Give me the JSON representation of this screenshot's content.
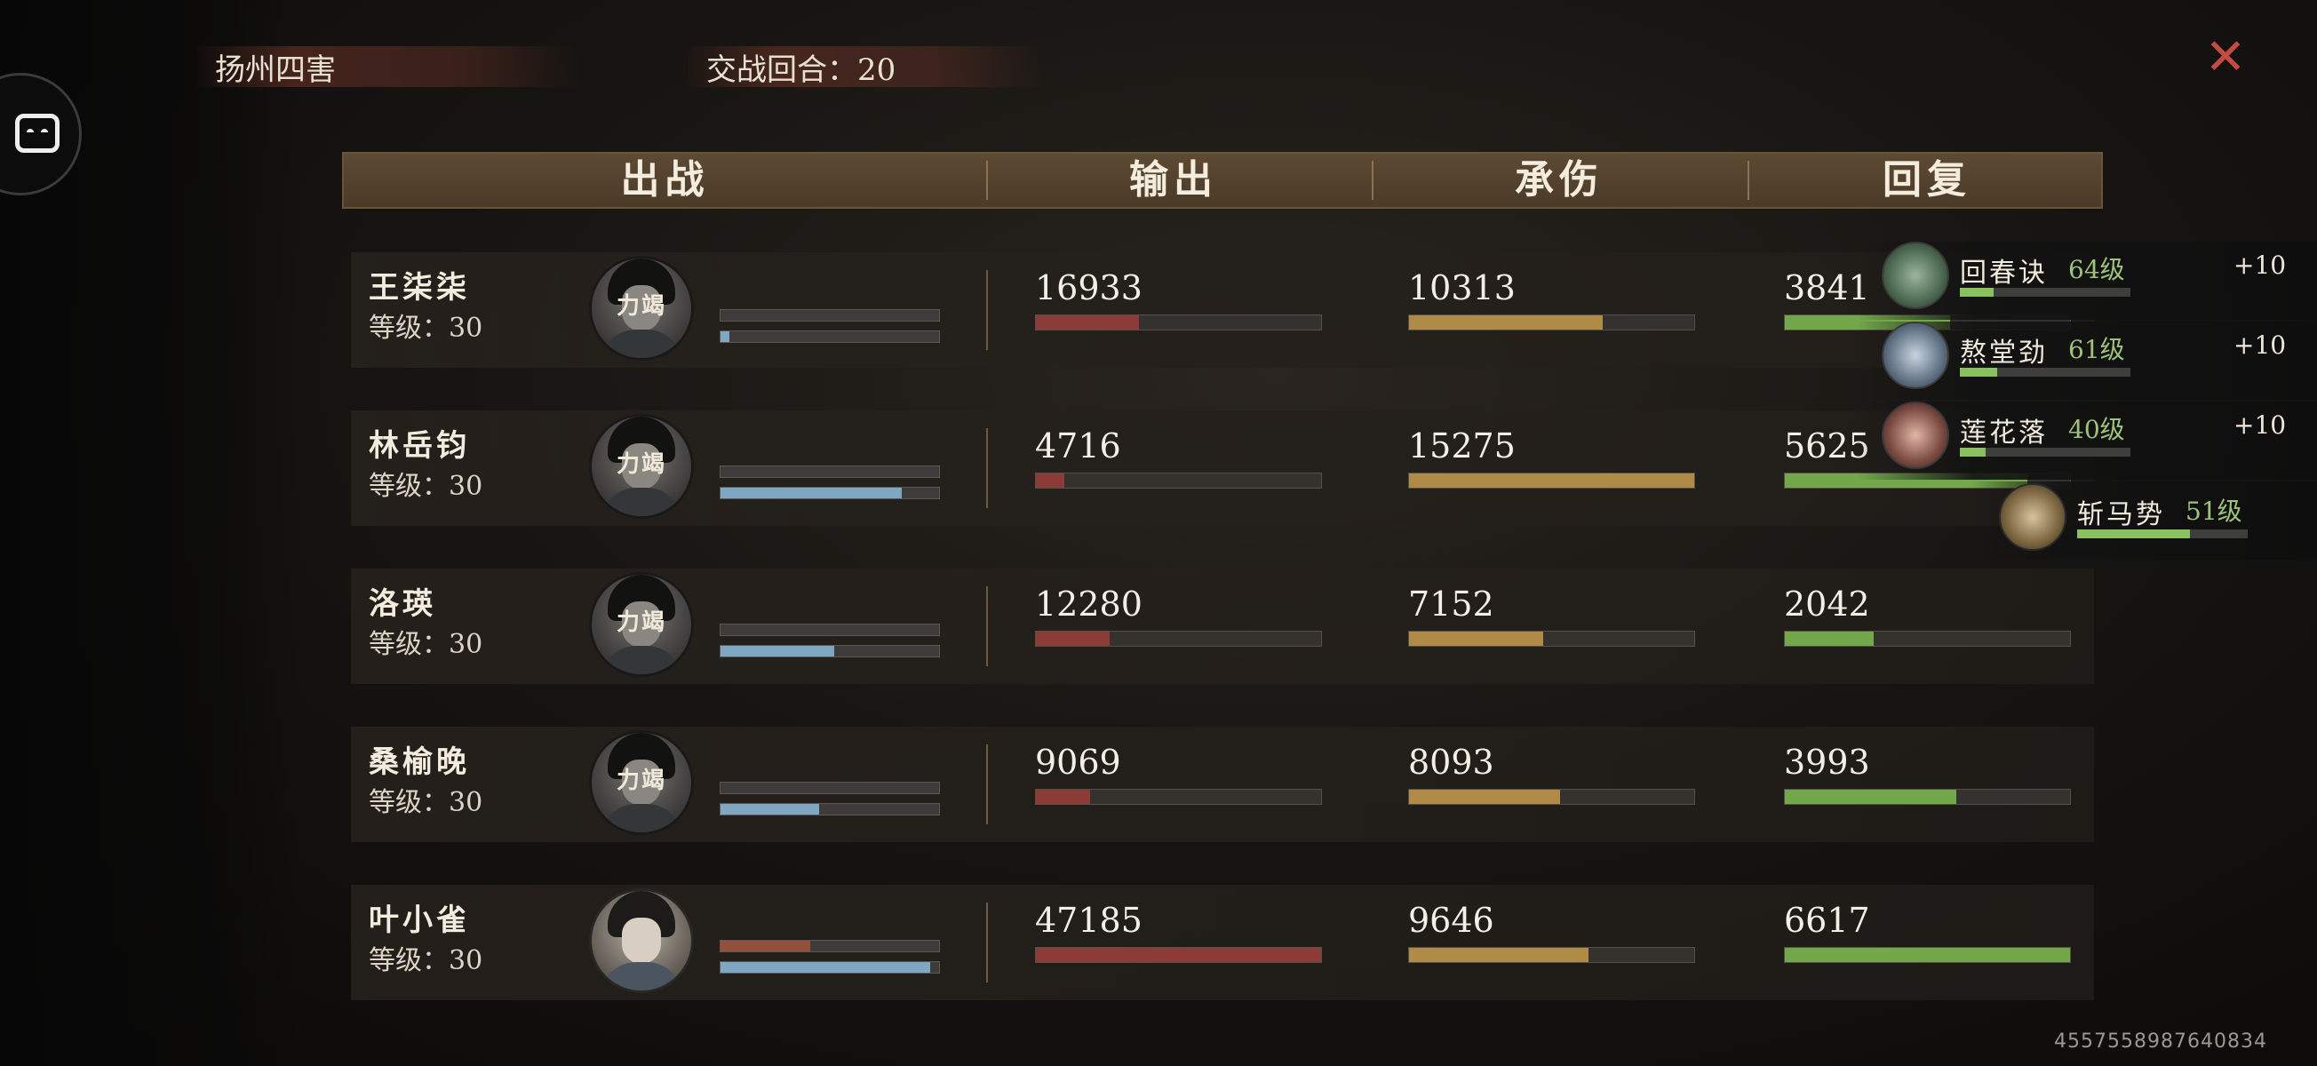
{
  "top": {
    "team_name": "扬州四害",
    "rounds_label": "交战回合：20",
    "close_icon": "close-icon",
    "side_icon": "face-icon"
  },
  "header": {
    "col_fighters": "出战",
    "col_output": "输出",
    "col_damage_taken": "承伤",
    "col_healing": "回复"
  },
  "colors": {
    "output": "#8d3b36",
    "damage_taken": "#b08b48",
    "healing": "#72a84a",
    "mini_blue": "#7fa7c2",
    "mini_rust": "#94503a"
  },
  "fighters": [
    {
      "name": "王柒柒",
      "level": "等级：30",
      "stamp": "力竭",
      "output": "16933",
      "output_pct": 36,
      "taken": "10313",
      "taken_pct": 68,
      "heal": "3841",
      "heal_pct": 58,
      "mini_top_pct": 0,
      "mini_bottom_pct": 4
    },
    {
      "name": "林岳钧",
      "level": "等级：30",
      "stamp": "力竭",
      "output": "4716",
      "output_pct": 10,
      "taken": "15275",
      "taken_pct": 100,
      "heal": "5625",
      "heal_pct": 85,
      "mini_top_pct": 0,
      "mini_bottom_pct": 83
    },
    {
      "name": "洛瑛",
      "level": "等级：30",
      "stamp": "力竭",
      "output": "12280",
      "output_pct": 26,
      "taken": "7152",
      "taken_pct": 47,
      "heal": "2042",
      "heal_pct": 31,
      "mini_top_pct": 0,
      "mini_bottom_pct": 52
    },
    {
      "name": "桑榆晚",
      "level": "等级：30",
      "stamp": "力竭",
      "output": "9069",
      "output_pct": 19,
      "taken": "8093",
      "taken_pct": 53,
      "heal": "3993",
      "heal_pct": 60,
      "mini_top_pct": 0,
      "mini_bottom_pct": 45
    },
    {
      "name": "叶小雀",
      "level": "等级：30",
      "stamp": "",
      "output": "47185",
      "output_pct": 100,
      "taken": "9646",
      "taken_pct": 63,
      "heal": "6617",
      "heal_pct": 100,
      "mini_top_pct": 41,
      "mini_bottom_pct": 96
    }
  ],
  "skills": [
    {
      "name": "回春诀",
      "level": "64级",
      "bonus": "+10",
      "progress_pct": 20
    },
    {
      "name": "熬堂劲",
      "level": "61级",
      "bonus": "+10",
      "progress_pct": 22
    },
    {
      "name": "莲花落",
      "level": "40级",
      "bonus": "+10",
      "progress_pct": 15
    },
    {
      "name": "斩马势",
      "level": "51级",
      "bonus": "",
      "progress_pct": 66
    }
  ],
  "footer": {
    "id_text": "4557558987640834"
  }
}
